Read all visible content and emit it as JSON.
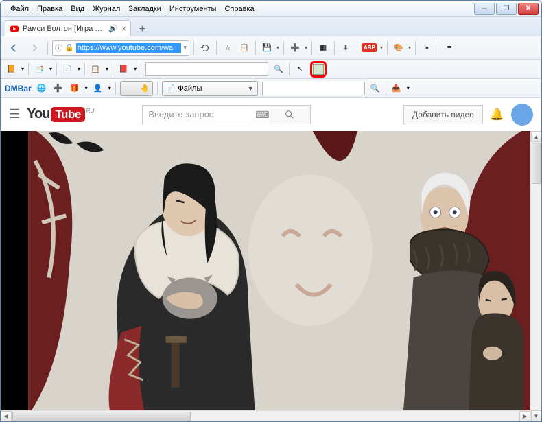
{
  "menu": {
    "items": [
      "Файл",
      "Правка",
      "Вид",
      "Журнал",
      "Закладки",
      "Инструменты",
      "Справка"
    ]
  },
  "tab": {
    "title": "Рамси Болтон [Игра п...",
    "sound_icon": "audio-icon"
  },
  "url": {
    "text": "https://www.youtube.com/wa"
  },
  "files_select": {
    "label": "Файлы"
  },
  "youtube": {
    "region": "RU",
    "logo_you": "You",
    "logo_tube": "Tube",
    "search_placeholder": "Введите запрос",
    "upload_label": "Добавить видео"
  },
  "toolbar3": {
    "dmbar": "DMBar"
  },
  "colors": {
    "highlight": "#ff0000",
    "youtube_red": "#cc181e",
    "url_select": "#3399ff"
  }
}
